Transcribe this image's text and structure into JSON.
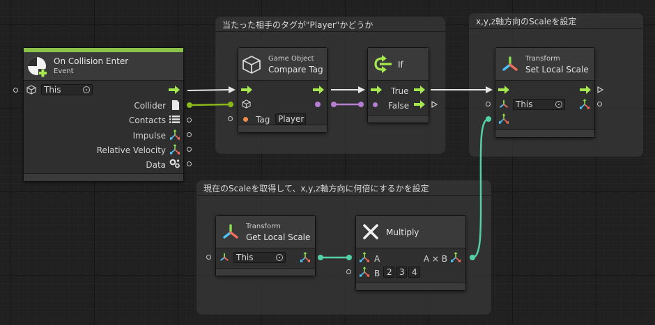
{
  "groups": {
    "compare": {
      "title": "当たった相手のタグが\"Player\"かどうか"
    },
    "set_scale": {
      "title": "x,y,z軸方向のScaleを設定"
    },
    "get_scale": {
      "title": "現在のScaleを取得して、x,y,z軸方向に何倍にするかを設定"
    }
  },
  "nodes": {
    "collision": {
      "title": "On Collision Enter",
      "subtitle": "Event",
      "target_value": "This",
      "outputs": [
        "Collider",
        "Contacts",
        "Impulse",
        "Relative Velocity",
        "Data"
      ]
    },
    "compare_tag": {
      "subtitle": "Game Object",
      "title": "Compare Tag",
      "tag_label": "Tag",
      "tag_value": "Player"
    },
    "if_node": {
      "title": "If",
      "true_label": "True",
      "false_label": "False"
    },
    "set_local_scale": {
      "subtitle": "Transform",
      "title": "Set Local Scale",
      "target_value": "This"
    },
    "get_local_scale": {
      "subtitle": "Transform",
      "title": "Get Local Scale",
      "target_value": "This"
    },
    "multiply": {
      "title": "Multiply",
      "input_a": "A",
      "input_b": "B",
      "output_label": "A × B",
      "b_values": [
        "2",
        "3",
        "4"
      ]
    }
  },
  "colors": {
    "flow": "#a6e94e",
    "gameobject": "#8ab81b",
    "bool": "#b57ed1",
    "vector3": "#54d1a4",
    "string": "#f08a4b",
    "header_bar": "#8ac24a",
    "connector": "#e6e6e6"
  }
}
